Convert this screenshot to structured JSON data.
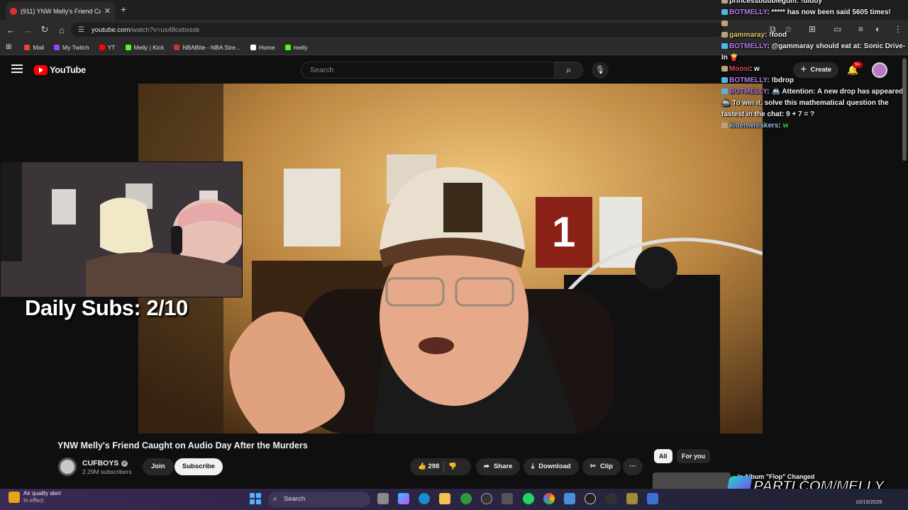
{
  "browser": {
    "tab_title": "(911) YNW Melly's Friend Ca",
    "tab_close": "✕",
    "new_tab": "+",
    "url_host": "youtube.com",
    "url_path": "/watch?v=us48cebxssk",
    "bookmarks": [
      {
        "label": "Mail",
        "color": "#ea4335"
      },
      {
        "label": "My Twitch",
        "color": "#9146ff"
      },
      {
        "label": "YT",
        "color": "#ff0000"
      },
      {
        "label": "Melly | Kick",
        "color": "#53fc18"
      },
      {
        "label": "NBABite - NBA Stre...",
        "color": "#c0392b"
      },
      {
        "label": "Home",
        "color": "#ffffff"
      },
      {
        "label": "melly",
        "color": "#53fc18"
      }
    ]
  },
  "youtube": {
    "logo_text": "YouTube",
    "search_placeholder": "Search",
    "create_label": "Create",
    "notif_badge": "9+",
    "video_title": "YNW Melly's Friend Caught on Audio Day After the Murders",
    "channel_name": "CUFBOYS",
    "subscriber_count": "2.29M subscribers",
    "join_label": "Join",
    "subscribe_label": "Subscribe",
    "like_count": "298",
    "share_label": "Share",
    "download_label": "Download",
    "clip_label": "Clip",
    "more_label": "···",
    "chips": [
      "All",
      "For you"
    ],
    "rec_title": "'s Album \"Flop\" Changed"
  },
  "overlay": {
    "daily_subs": "Daily Subs: 2/10",
    "parti": "PARTI.COM/MELLY"
  },
  "chat": [
    {
      "user": "princessbubblegum",
      "user_color": "#f5f5f5",
      "text": ": !diddy",
      "badge": "#b9a27a"
    },
    {
      "user": "BOTMELLY",
      "user_color": "#b07cf0",
      "text": ": ***** has now been said 5605 times!",
      "badge": "#4fb6e8"
    },
    {
      "user": "",
      "user_color": "#f5f5f5",
      "text": "",
      "badge": "#c4a06a"
    },
    {
      "user": "gammaray",
      "user_color": "#e8c66a",
      "text": ": !food",
      "badge": "#b9a27a"
    },
    {
      "user": "BOTMELLY",
      "user_color": "#b07cf0",
      "text": ": @gammaray should eat at: Sonic Drive-In 🍟",
      "badge": "#4fb6e8"
    },
    {
      "user": "Moosi",
      "user_color": "#e0425a",
      "text": ": w",
      "badge": "#b9a27a"
    },
    {
      "user": "BOTMELLY",
      "user_color": "#b07cf0",
      "text": ": !bdrop",
      "badge": "#4fb6e8"
    },
    {
      "user": "BOTMELLY",
      "user_color": "#b07cf0",
      "text": ": 🚢 Attention: A new drop has appeared 🚢 To win it, solve this mathematical question the fastest in the chat: 9 + 7 = ?",
      "badge": "#4fb6e8"
    },
    {
      "user": "kittenwhiskers",
      "user_color": "#9ab8e8",
      "text": ": ",
      "badge": "#b9a27a",
      "extra": "w",
      "extra_color": "#3bd15a"
    }
  ],
  "taskbar": {
    "alert_title": "Air quality alert",
    "alert_sub": "In effect",
    "search_label": "Search",
    "date": "10/15/2025"
  }
}
